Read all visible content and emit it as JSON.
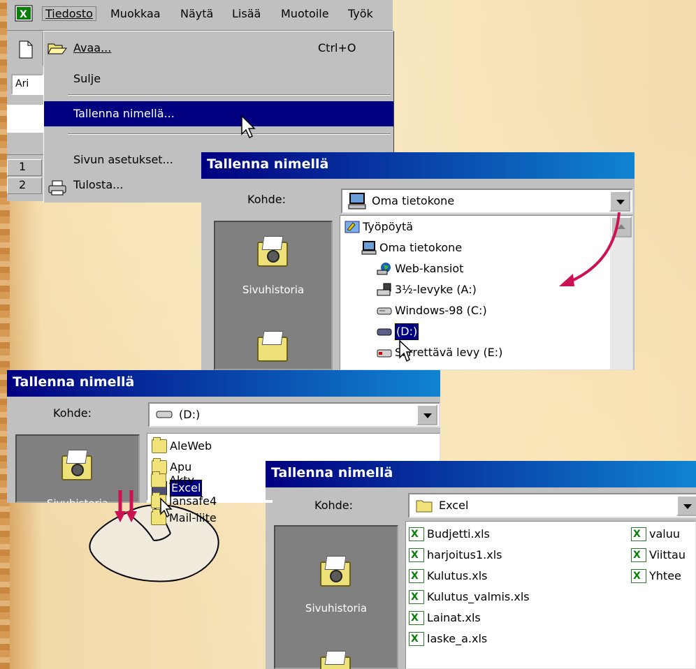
{
  "excel": {
    "menu": [
      "Tiedosto",
      "Muokkaa",
      "Näytä",
      "Lisää",
      "Muotoile",
      "Työk"
    ],
    "font_box": "Ari",
    "row_headers": [
      "1",
      "2"
    ]
  },
  "file_menu": {
    "items": [
      {
        "label": "Avaa...",
        "shortcut": "Ctrl+O"
      },
      {
        "label": "Sulje"
      },
      {
        "label": "Tallenna nimellä..."
      },
      {
        "label": "Sivun asetukset..."
      },
      {
        "label": "Tulosta..."
      }
    ]
  },
  "dialog1": {
    "title": "Tallenna nimellä",
    "location_label": "Kohde:",
    "location_value": "Oma tietokone",
    "places": [
      "Sivuhistoria"
    ],
    "tree": [
      {
        "label": "Työpöytä",
        "icon": "desktop-icon"
      },
      {
        "label": "Oma tietokone",
        "icon": "computer-icon"
      },
      {
        "label": "Web-kansiot",
        "icon": "web-folders-icon"
      },
      {
        "label": "3½-levyke (A:)",
        "icon": "floppy-icon"
      },
      {
        "label": "Windows-98 (C:)",
        "icon": "drive-icon"
      },
      {
        "label": "(D:)",
        "icon": "drive-icon",
        "selected": true
      },
      {
        "label": "Siirrettävä levy (E:)",
        "icon": "removable-drive-icon"
      }
    ]
  },
  "dialog2": {
    "title": "Tallenna nimellä",
    "location_label": "Kohde:",
    "location_value": "(D:)",
    "places": [
      "Sivuhistoria"
    ],
    "items": [
      {
        "label": "AleWeb"
      },
      {
        "label": "Apu"
      },
      {
        "label": "Excel",
        "selected": true
      },
      {
        "label": "Aktv"
      },
      {
        "label": "lansafe4"
      },
      {
        "label": "Mail-liite"
      }
    ]
  },
  "dialog3": {
    "title": "Tallenna nimellä",
    "location_label": "Kohde:",
    "location_value": "Excel",
    "places": [
      "Sivuhistoria"
    ],
    "files_col1": [
      "Budjetti.xls",
      "harjoitus1.xls",
      "Kulutus.xls",
      "Kulutus_valmis.xls",
      "Lainat.xls",
      "laske_a.xls"
    ],
    "files_col2": [
      "valuu",
      "Viittau",
      "Yhtee"
    ]
  },
  "colors": {
    "title_bar": "#000080",
    "selection": "#000080",
    "window": "#c0c0c0",
    "arrow": "#cc1155"
  }
}
